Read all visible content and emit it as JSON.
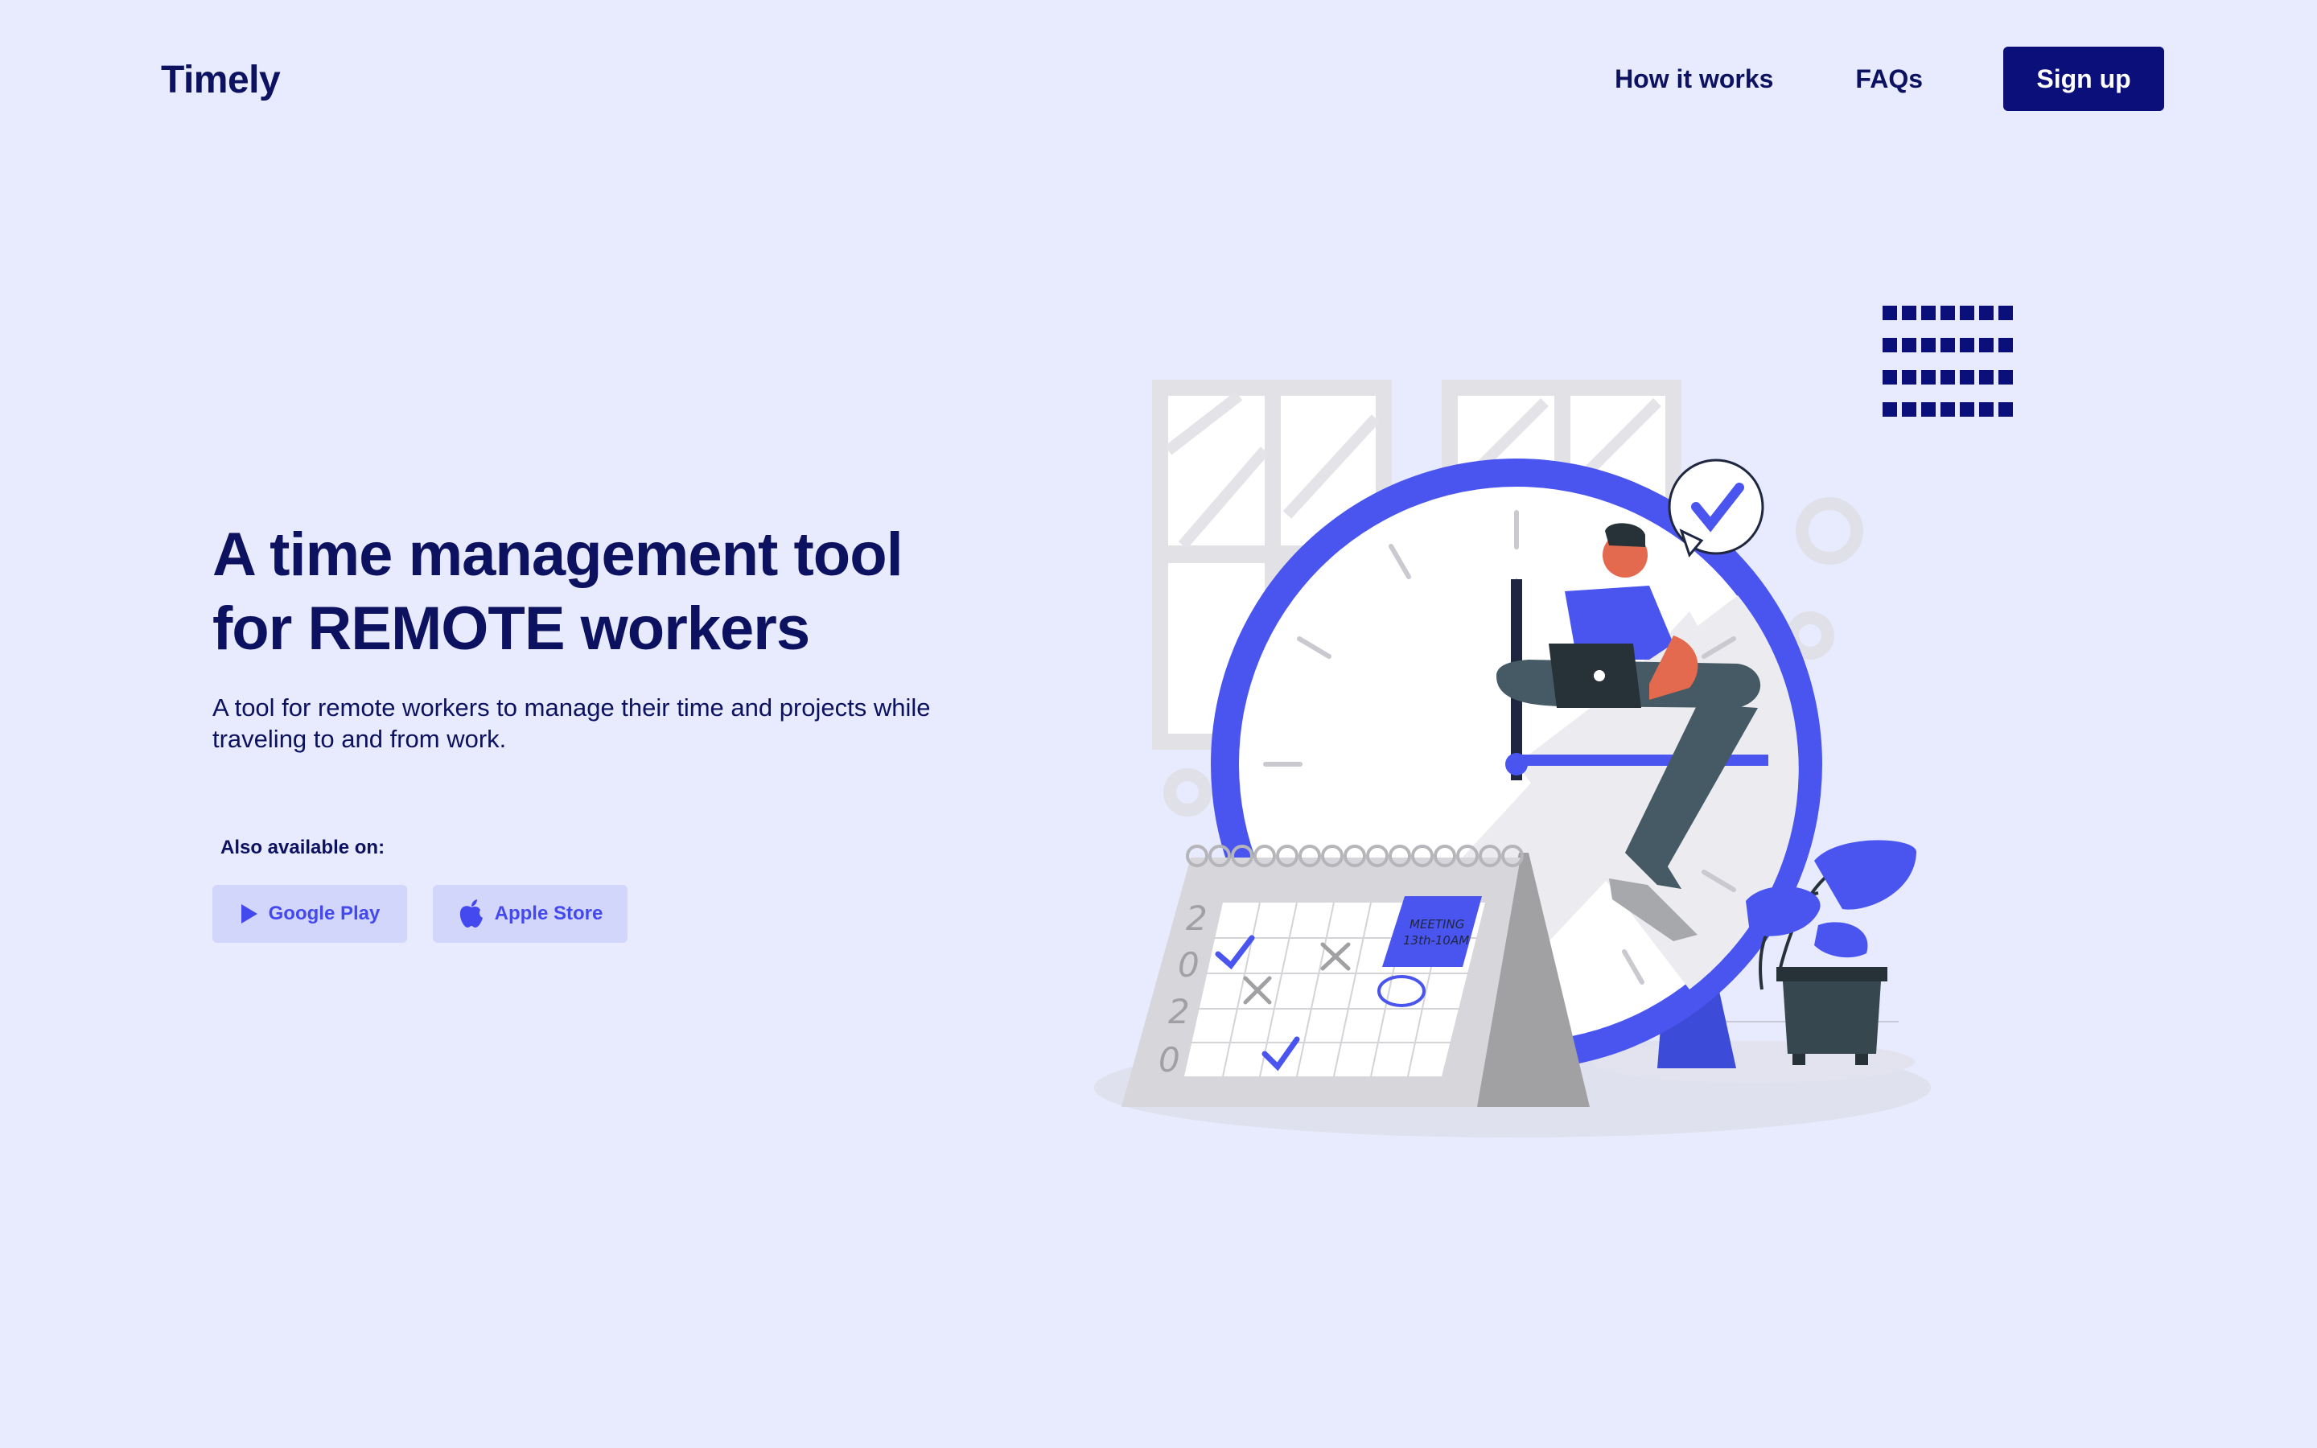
{
  "header": {
    "logo": "Timely",
    "nav": [
      "How it works",
      "FAQs"
    ],
    "signup_label": "Sign up"
  },
  "hero": {
    "title_line1": "A time management tool",
    "title_line2": "for REMOTE workers",
    "subtitle": "A tool for remote workers to manage their time and projects while traveling to and from work.",
    "available_label": "Also available on:",
    "stores": [
      {
        "label": "Google Play",
        "icon": "play-icon"
      },
      {
        "label": "Apple Store",
        "icon": "apple-icon"
      }
    ]
  },
  "illustration": {
    "calendar_year": [
      "2",
      "0",
      "2",
      "0"
    ],
    "meeting_line1": "MEETING",
    "meeting_line2": "13th-10AM"
  },
  "colors": {
    "background": "#e8ebfd",
    "primary": "#0a0f7a",
    "accent": "#4a55f0",
    "store_button": "#d2d6fb"
  }
}
